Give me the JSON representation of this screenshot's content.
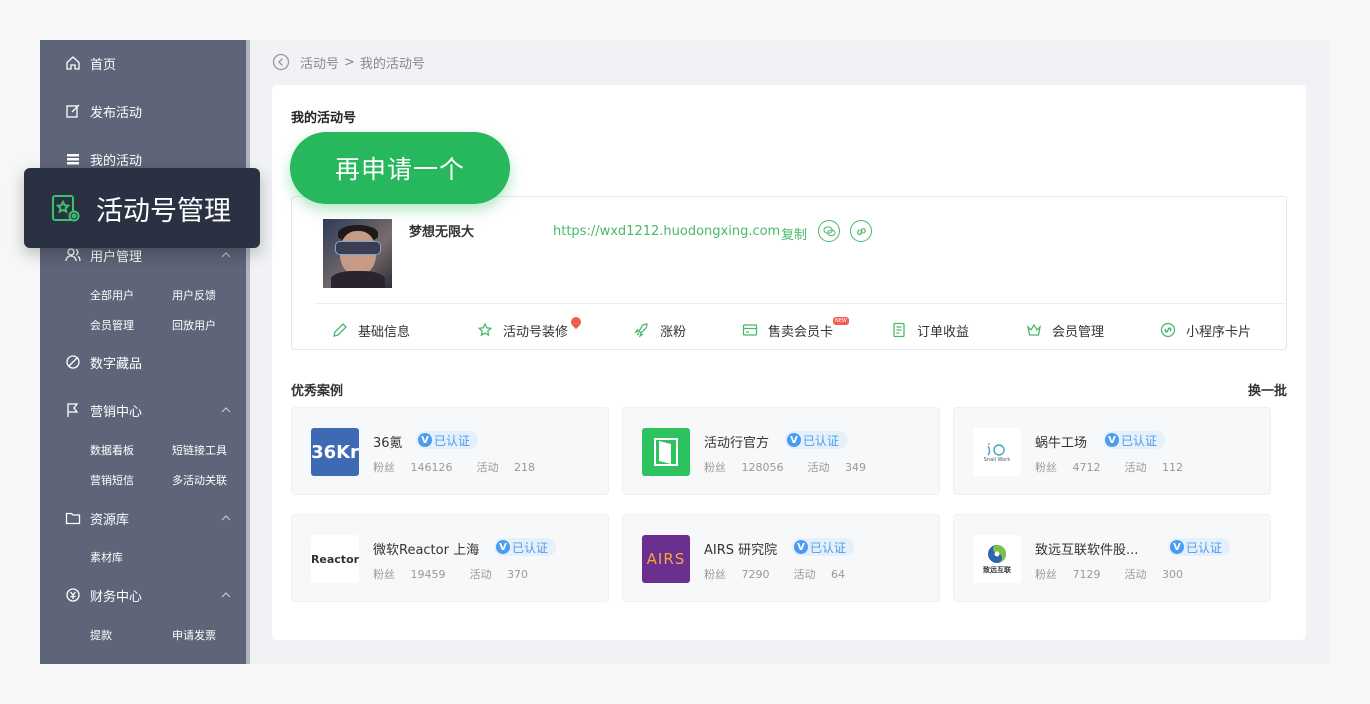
{
  "sidebar": {
    "items": [
      {
        "label": "首页",
        "icon": "home-icon"
      },
      {
        "label": "发布活动",
        "icon": "edit-icon"
      },
      {
        "label": "我的活动",
        "icon": "list-icon"
      },
      {
        "label": "用户管理",
        "icon": "users-icon"
      },
      {
        "label": "数字藏品",
        "icon": "nft-icon"
      },
      {
        "label": "营销中心",
        "icon": "flag-icon"
      },
      {
        "label": "资源库",
        "icon": "folder-icon"
      },
      {
        "label": "财务中心",
        "icon": "finance-icon"
      }
    ],
    "sub_users": [
      "全部用户",
      "用户反馈",
      "会员管理",
      "回放用户"
    ],
    "sub_marketing": [
      "数据看板",
      "短链接工具",
      "营销短信",
      "多活动关联"
    ],
    "sub_resources": [
      "素材库"
    ],
    "sub_finance": [
      "提款",
      "申请发票"
    ],
    "active": {
      "label": "活动号管理",
      "icon": "badge-star-icon"
    }
  },
  "breadcrumb": {
    "root": "活动号",
    "sep": ">",
    "current": "我的活动号"
  },
  "panel": {
    "title": "我的活动号",
    "apply_button": "再申请一个",
    "account": {
      "name": "梦想无限大",
      "url": "https://wxd1212.huodongxing.com",
      "copy_label": "复制"
    },
    "actions": [
      {
        "label": "基础信息",
        "icon": "pencil-icon"
      },
      {
        "label": "活动号装修",
        "icon": "decorate-icon"
      },
      {
        "label": "涨粉",
        "icon": "rocket-icon"
      },
      {
        "label": "售卖会员卡",
        "icon": "card-icon"
      },
      {
        "label": "订单收益",
        "icon": "order-icon"
      },
      {
        "label": "会员管理",
        "icon": "crown-icon"
      },
      {
        "label": "小程序卡片",
        "icon": "miniapp-icon"
      }
    ],
    "new_badge": "NEW",
    "cases_title": "优秀案例",
    "refresh_label": "换一批",
    "verified_label": "已认证",
    "fans_label": "粉丝",
    "events_label": "活动",
    "cases": [
      {
        "name": "36氪",
        "fans": "146126",
        "events": "218",
        "logo_text": "36Kr",
        "logo_color": "#3e6ab5"
      },
      {
        "name": "活动行官方",
        "fans": "128056",
        "events": "349",
        "logo_text": "",
        "logo_color": "#2cc35e"
      },
      {
        "name": "蜗牛工场",
        "fans": "4712",
        "events": "112",
        "logo_text": "Snail Work",
        "logo_color": "#ffffff"
      },
      {
        "name": "微软Reactor 上海",
        "fans": "19459",
        "events": "370",
        "logo_text": "Reactor",
        "logo_color": "#ffffff"
      },
      {
        "name": "AIRS 研究院",
        "fans": "7290",
        "events": "64",
        "logo_text": "AIRS",
        "logo_color": "#6a2f8f"
      },
      {
        "name": "致远互联软件股...",
        "fans": "7129",
        "events": "300",
        "logo_text": "致远互联",
        "logo_color": "#ffffff"
      }
    ]
  },
  "colors": {
    "sidebar": "#5e6578",
    "accent": "#27b75c",
    "link": "#4ab86a",
    "verified": "#4a9cf0"
  }
}
